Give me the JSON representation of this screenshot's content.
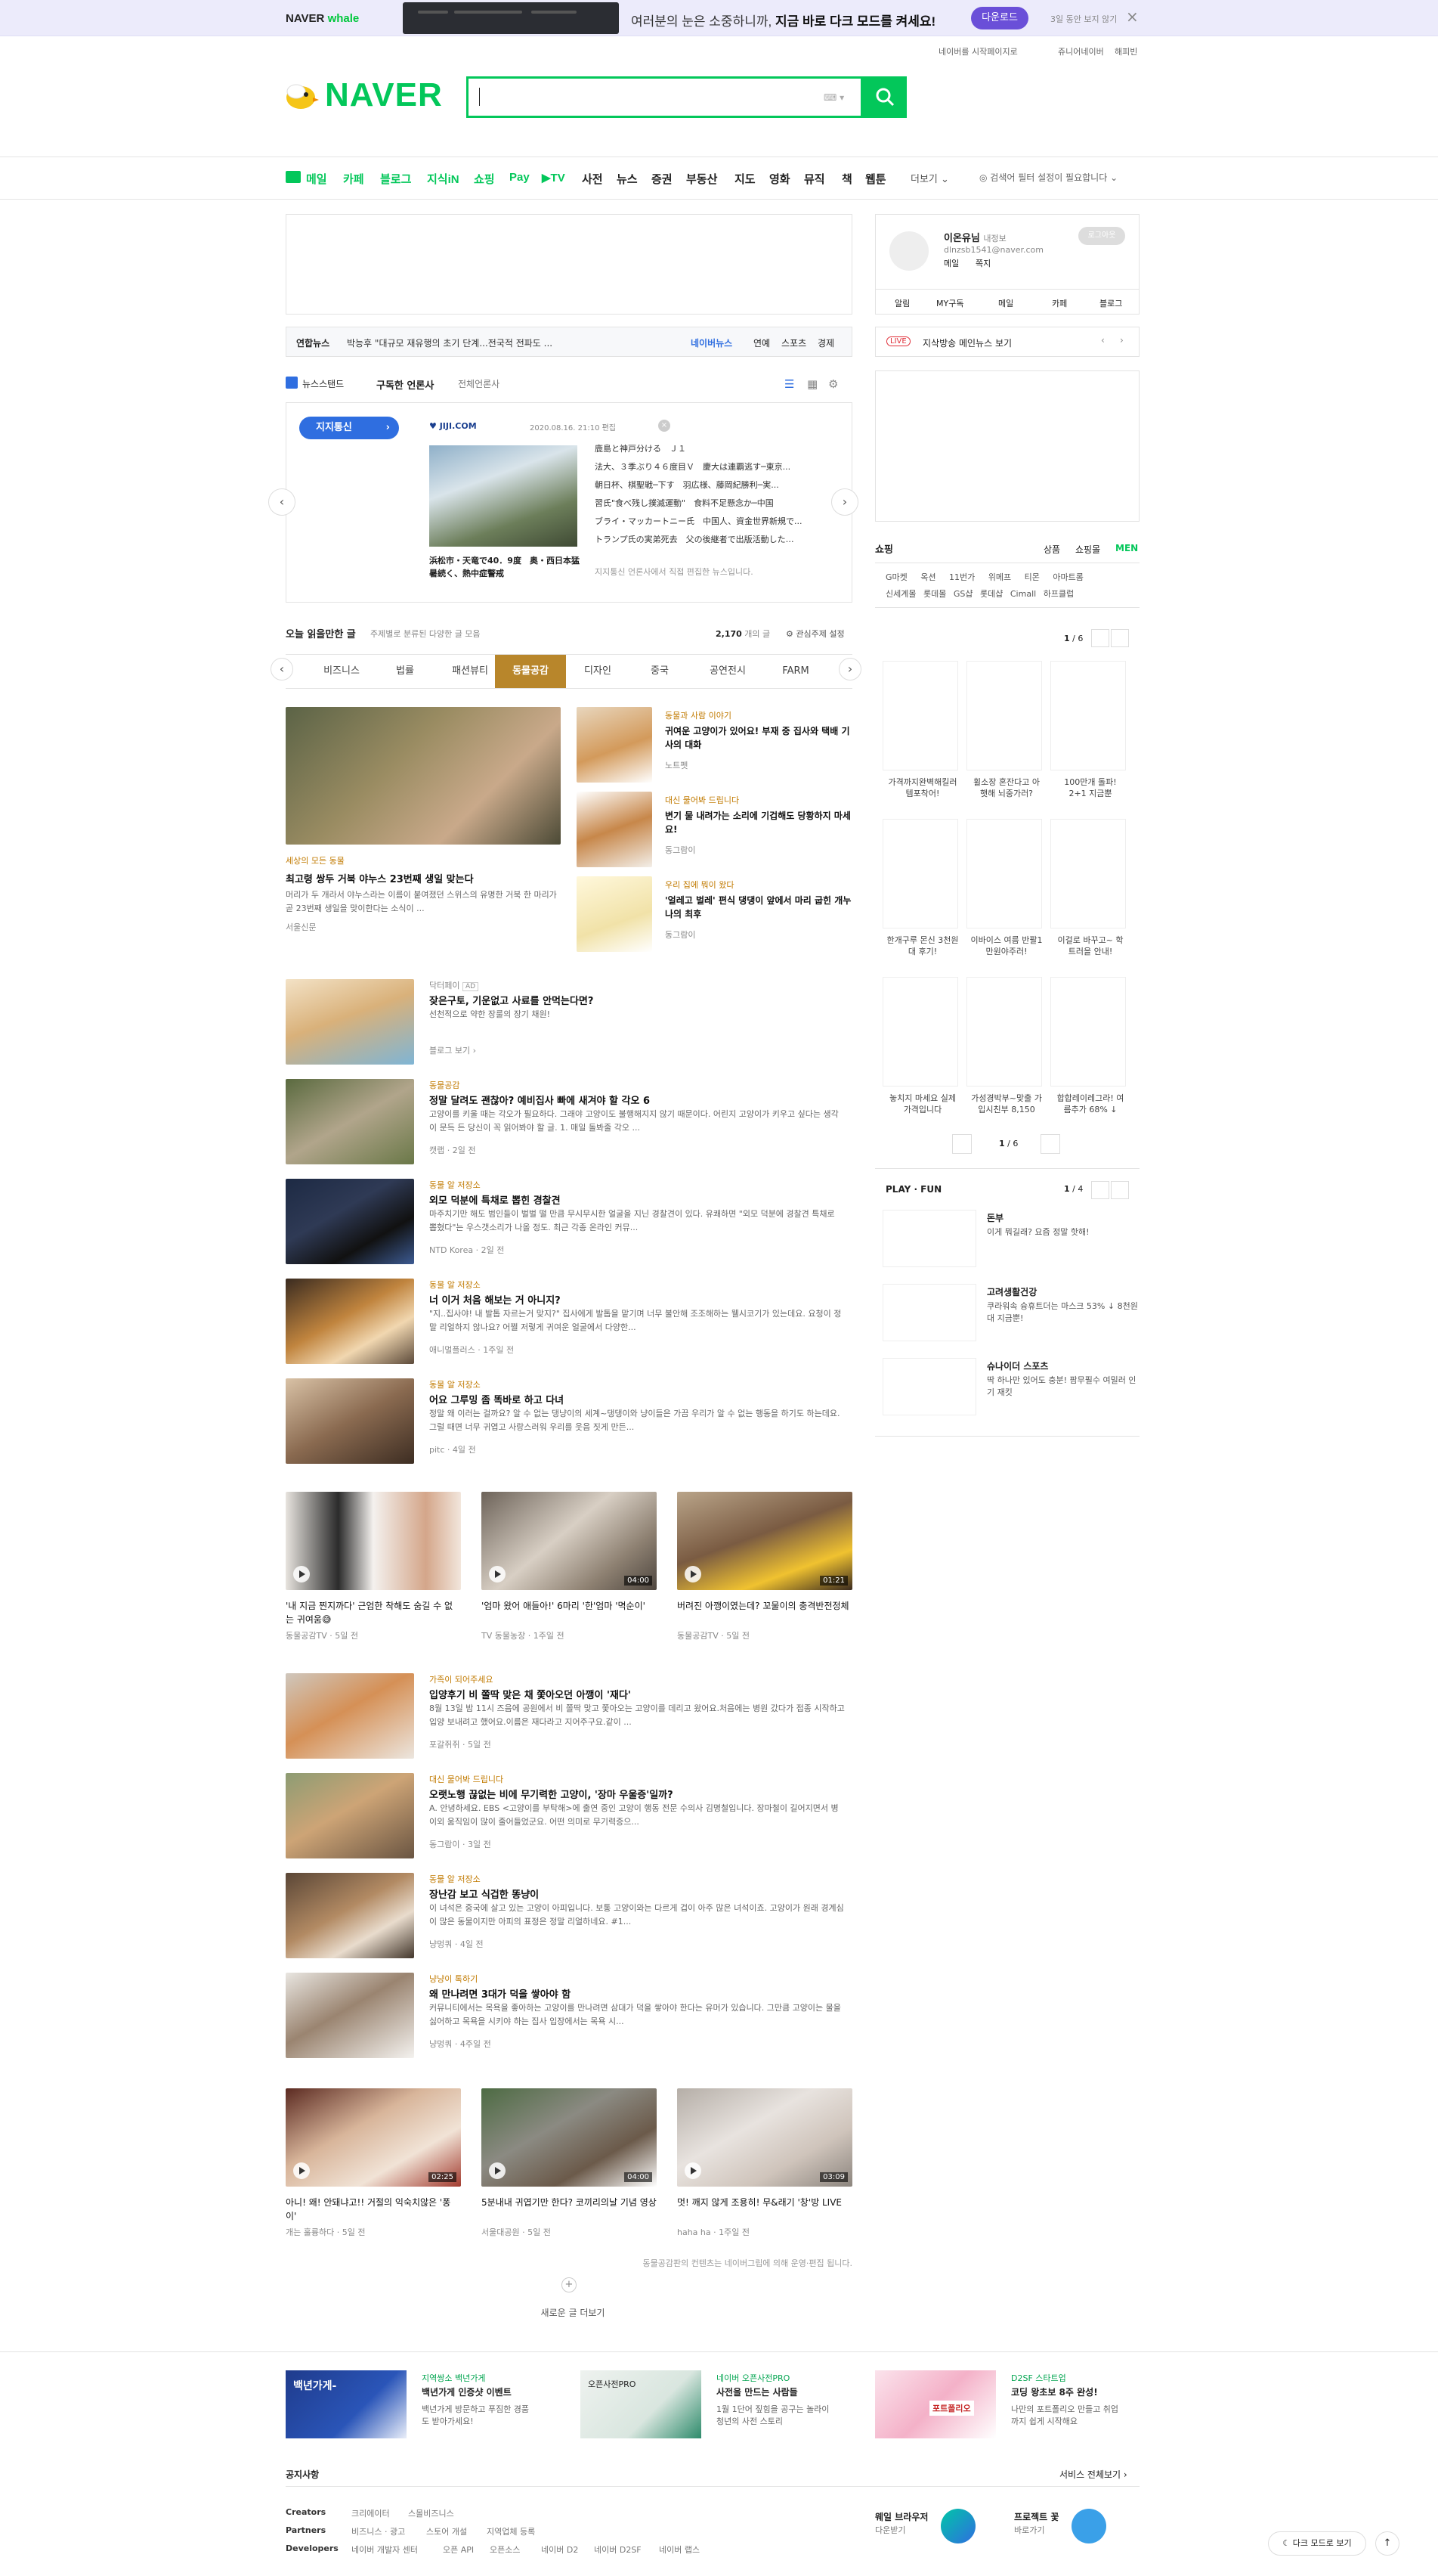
{
  "whalebar": {
    "brand_a": "NAVER",
    "brand_b": "whale",
    "message_pre": "여러분의 눈은 소중하니까, ",
    "message_bold": "지금 바로 다크 모드를 켜세요!",
    "download": "다운로드",
    "later": "3일 동안 보지 않기"
  },
  "toplinks": {
    "set_home": "네이버를 시작페이지로",
    "junior": "쥬니어네이버",
    "happybean": "해피빈"
  },
  "logo": {
    "text": "NAVER"
  },
  "nav": {
    "items": [
      "메일",
      "카페",
      "블로그",
      "지식iN",
      "쇼핑",
      "Pay",
      "▶TV",
      "사전",
      "뉴스",
      "증권",
      "부동산",
      "지도",
      "영화",
      "뮤직",
      "책",
      "웹툰"
    ],
    "more": "더보기",
    "setting": "검색어 필터 설정이 필요합니다"
  },
  "newsbar": {
    "press": "연합뉴스",
    "headline": "박능후 \"대규모 재유행의 초기 단계...전국적 전파도 ...",
    "naver_news": "네이버뉴스",
    "cats": [
      "연예",
      "스포츠",
      "경제"
    ]
  },
  "newsstand": {
    "label": "뉴스스탠드",
    "sub": "구독한 언론사",
    "all": "전체언론사",
    "press_btn": "지지통신",
    "press_logo": "JIJI.COM",
    "date": "2020.08.16. 21:10 편집",
    "photo_caption": "浜松市・天竜で40．9度　奥・西日本猛暑続く、熱中症警戒",
    "headlines": [
      "鹿島と神戸分ける　Ｊ１",
      "法大、３季ぶり４６度目Ｖ　慶大は連覇逃す─東京...",
      "朝日杯、棋聖戦─下す　羽広様、藤岡紀勝利─実...",
      "習氏\"食べ残し撲滅運動\"　食料不足懸念か─中国",
      "ブライ・マッカートニー氏　中国人、資金世界新規で...",
      "トランプ氏の実弟死去　父の後継者で出版活動した…"
    ],
    "notice": "지지통신 언론사에서 직접 편집한 뉴스입니다."
  },
  "feed": {
    "title": "오늘 읽을만한 글",
    "sub": "주제별로 분류된 다양한 글 모음",
    "count": "2,170",
    "count_unit": "개의 글",
    "setting": "관심주제 설정",
    "tabs": [
      "비즈니스",
      "법률",
      "패션뷰티",
      "동물공감",
      "디자인",
      "중국",
      "공연전시",
      "FARM"
    ],
    "active_tab": "동물공감"
  },
  "big": {
    "cat": "세상의 모든 동물",
    "title": "최고령 쌍두 거북 야누스 23번째 생일 맞는다",
    "desc": "머리가 두 개라서 야누스라는 이름이 붙여졌던 스위스의 유명한 거북 한 마리가 곧 23번째 생일을 맞이한다는 소식이 ...",
    "src": "서울신문"
  },
  "small": [
    {
      "cat": "동물과 사람 이야기",
      "title": "귀여운 고양이가 있어요! 부재 중 집사와 택배 기사의 대화",
      "src": "노트펫"
    },
    {
      "cat": "대신 물어봐 드립니다",
      "title": "변기 물 내려가는 소리에 기겁해도 당황하지 마세요!",
      "src": "동그람이"
    },
    {
      "cat": "우리 집에 뭐이 왔다",
      "title": "'얼레고 벌레' 편식 댕댕이 앞에서 마리 굽힌 개누나의 최후",
      "src": "동그람이"
    }
  ],
  "rows1": [
    {
      "cat": "닥터페이",
      "title": "잦은구토, 기운없고 사료를 안먹는다면?",
      "desc": "선천적으로 약한 장룰의 장기 채원!",
      "src": "블로그 보기"
    },
    {
      "cat": "동물공감",
      "title": "정말 달려도 괜찮아? 예비집사 빠에 새겨야 할 각오 6",
      "desc": "고양이를 키울 때는 각오가 필요하다. 그래야 고양이도 불행해지지 않기 때문이다. 어린지 고양이가 키우고 싶다는 생각이 문득 든 당신이 꼭 읽어봐야 할 글. 1. 매일 돌봐줄 각오 ...",
      "src": "캣랩 · 2일 전"
    },
    {
      "cat": "동물 알 저장소",
      "title": "외모 덕분에 특채로 뽑힌 경찰견",
      "desc": "마주치기만 해도 범인들이 벌벌 떨 만큼 무시무시한 얼굴을 지닌 경찰견이 있다. 유쾌하면 \"외모 덕분에 경찰견 특채로 뽑혔다\"는 우스갯소리가 나올 정도. 최근 각종 온라인 커뮤...",
      "src": "NTD Korea · 2일 전"
    },
    {
      "cat": "동물 알 저장소",
      "title": "너 이거 처음 해보는 거 아니지?",
      "desc": "\"지..집사야! 내 발톱 자르는거 맞지?\" 집사에게 발톱을 맡기며 너무 불안해 조조해하는 웰시코기가 있는데요. 요청이 정말 리얼하지 않나요? 어쩔 저렇게 귀여운 얼굴에서 다양한...",
      "src": "애니멀플러스 · 1주일 전"
    },
    {
      "cat": "동물 알 저장소",
      "title": "어요 그루밍 좀 똑바로 하고 다녀",
      "desc": "정말 왜 이러는 걸까요? 알 수 없는 댕냥이의 세계~댕댕이와 냥이들은 가끔 우리가 알 수 없는 행동을 하기도 하는데요. 그럴 때면 너무 귀엽고 사랑스러워 우리를 웃음 짓게 만든...",
      "src": "pitc · 4일 전"
    }
  ],
  "videos1": [
    {
      "title": "'내 지금 찐지까다' 근엄한 착해도 숨길 수 없는 귀여움😅",
      "src": "동물공감TV · 5일 전",
      "dur": ""
    },
    {
      "title": "'엄마 왔어 애들아!' 6마리 '한'엄마 '멱순이'",
      "src": "TV 동물농장 · 1주일 전",
      "dur": "04:00"
    },
    {
      "title": "버려진 아깽이였는데? 꼬물이의 충격반전정체",
      "src": "동물공감TV · 5일 전",
      "dur": "01:21"
    }
  ],
  "rows2": [
    {
      "cat": "가족이 되어주세요",
      "title": "입양후기 비 쫄딱 맞은 채 쫓아오던 아깽이 '재다'",
      "desc": "8월 13일 밤 11시 즈음에 공원에서 비 쫄딱 맞고 쫓아오는 고양이를 데리고 왔어요.처음에는 병원 갔다가 접종 시작하고 입양 보내려고 했어요.이름은 재다라고 지어주구요.같이 ...",
      "src": "포갈쥐쥐 · 5일 전"
    },
    {
      "cat": "대신 물어봐 드립니다",
      "title": "오랫노행 끊없는 비에 무기력한 고양이, '장마 우울증'일까?",
      "desc": "A. 안녕하세요. EBS <고양이를 부탁해>에 출연 중인 고양이 행동 전문 수의사 김명철입니다. 장마철이 길어지면서 병이외 움직임이 많이 줄어들었군요. 어떤 의미로 무기력증으...",
      "src": "동그람이 · 3일 전"
    },
    {
      "cat": "동물 알 저장소",
      "title": "장난감 보고 식겁한 똥냥이",
      "desc": "이 녀석은 중국에 살고 있는 고양이 아피입니다. 보통 고양이와는 다르게 겁이 아주 많은 녀석이죠. 고양이가 원래 경계심이 많은 동물이지만 아피의 표정은 정말 리얼하네요. #1...",
      "src": "냥멍쿼 · 4일 전"
    },
    {
      "cat": "냥냥이 톡하기",
      "title": "왜 만나려면 3대가 덕을 쌓아야 함",
      "desc": "커뮤니티에서는 목욕을 좋아하는 고양이를 만나려면 삼대가 덕을 쌓아야 한다는 유머가 있습니다. 그만큼 고양이는 물을 싫어하고 목욕을 시키야 하는 집사 입장에서는 목욕 시...",
      "src": "냥멍쿼 · 4주일 전"
    }
  ],
  "videos2": [
    {
      "title": "아니! 왜! 안돼냐고!! 거절의 익숙치않은 '퐁이'",
      "src": "개는 훌륭하다 · 5일 전",
      "dur": "02:25"
    },
    {
      "title": "5분내내 귀엽기만 한다? 코끼리의날 기념 영상",
      "src": "서울대공원 · 5일 전",
      "dur": "04:00"
    },
    {
      "title": "멋! 깨지 않게 조용히! 무&래기 '창'방 LIVE",
      "src": "haha ha · 1주일 전",
      "dur": "03:09"
    }
  ],
  "feed_footer": {
    "notice": "동물공감판의 컨텐츠는 네이버그립에 의해 운영·편집 됩니다.",
    "more": "새로운 글 더보기"
  },
  "login": {
    "name": "이온유님",
    "badge": "내정보",
    "email": "dlnzsb1541@naver.com",
    "mail": "메일",
    "note": "쪽지",
    "logout": "로그아웃",
    "tabs": [
      "알림",
      "MY구독",
      "메일",
      "카페",
      "블로그"
    ]
  },
  "live": {
    "badge": "LIVE",
    "text": "지삭방송 메인뉴스 보기"
  },
  "shopping": {
    "title": "쇼핑",
    "tabs": [
      "상품",
      "쇼핑몰",
      "MEN"
    ],
    "cats1": [
      "G마켓",
      "옥션",
      "11번가",
      "위메프",
      "티몬",
      "아마트롬"
    ],
    "cats2": [
      "신세계몰",
      "롯데몰",
      "GS샵",
      "롯데샵",
      "Cimall",
      "하프클럽"
    ],
    "page": "1",
    "pages": "6",
    "items": [
      "가격까지완벽해킬러템포착어!",
      "휠소장 혼잔다고 아햇해 뇌중가러?",
      "100만개 돌파! 2+1 지금뿐",
      "한개구루 몬신 3천원대 후기!",
      "이바이스 여름 반팔1만원야주러!",
      "이걸로 바꾸고~ 학트러을 안내!",
      "놓치지 마세요 실제 가격입니다",
      "가성경박부~맞출 가입시친부 8,150",
      "합합레이레그라! 여름추가 68% ↓"
    ]
  },
  "playfun": {
    "title": "PLAY · FUN",
    "page": "1",
    "pages": "4",
    "items": [
      {
        "a": "돈부",
        "b": "이게 뭐길래? 요즘 정말 핫해!"
      },
      {
        "a": "고려생활건강",
        "b": "쿠라워속 슝휴트더는 마스크 53% ↓ 8천원대 지금뿐!"
      },
      {
        "a": "슈나이더 스포츠",
        "b": "딱 하나만 있어도 충분! 팜무필수 여밀러 인기 재킷"
      }
    ]
  },
  "footer_ads": [
    {
      "head": "지역쌍소 백년가게",
      "title": "백년가게 인증샷 이벤트",
      "desc": "백년가게 방문하고 푸짐한 경품도 받아가세요!",
      "img": "백년가게-"
    },
    {
      "head": "네이버 오픈사전PRO",
      "title": "사전을 만드는 사람들",
      "desc": "1월 1단어 짚힘을 공구는 놀라이 청년의 사전 스토리",
      "img": "오픈사전PRO"
    },
    {
      "head": "D2SF 스타트업",
      "title": "코딩 왕초보 8주 완성!",
      "desc": "나만의 포트폴리오 만들고 취업까지 쉽게 시작해요",
      "img": "포트폴리오"
    }
  ],
  "footer": {
    "notice": "공지사항",
    "service_all": "서비스 전체보기",
    "creators": "Creators",
    "partners": "Partners",
    "developers": "Developers",
    "creator_links": [
      "크리에이터",
      "스몰비즈니스"
    ],
    "partner_links": [
      "비즈니스 · 광고",
      "스토어 개설",
      "지역업체 등록"
    ],
    "dev_links": [
      "네이버 개발자 센터",
      "오픈 API",
      "오픈소스",
      "네이버 D2",
      "네이버 D2SF",
      "네이버 랩스"
    ],
    "whale_title": "웨일 브라우저",
    "whale_sub": "다운받기",
    "pro_title": "프로젝트 꽃",
    "pro_sub": "바로가기",
    "dark_btn": "다크 모드로 보기"
  },
  "colors": {
    "green": "#03c75a",
    "purple": "#6a4fd8",
    "gold": "#b8862b",
    "blue": "#2f6ee0"
  }
}
